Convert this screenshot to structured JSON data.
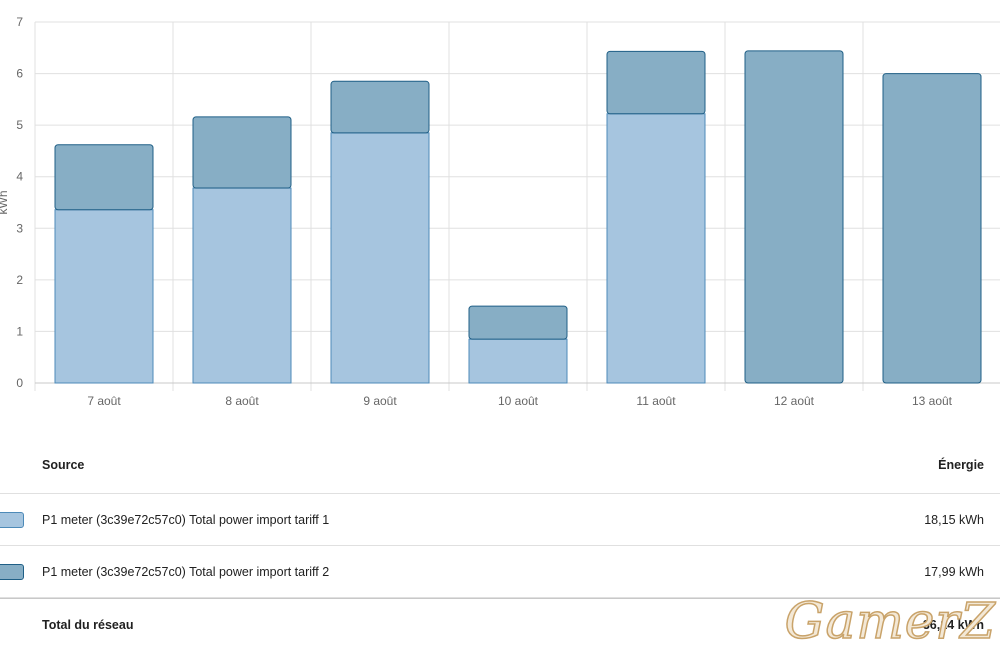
{
  "chart_data": {
    "type": "bar",
    "stacked": true,
    "ylabel": "kWh",
    "ylim": [
      0,
      7
    ],
    "yticks": [
      0,
      1,
      2,
      3,
      4,
      5,
      6,
      7
    ],
    "categories": [
      "7 août",
      "8 août",
      "9 août",
      "10 août",
      "11 août",
      "12 août",
      "13 août"
    ],
    "series": [
      {
        "name": "P1 meter (3c39e72c57c0) Total power import tariff 1",
        "values": [
          3.36,
          3.78,
          4.85,
          0.85,
          5.22,
          0,
          0
        ],
        "color": "#a6c5df",
        "border": "#4d8ab8"
      },
      {
        "name": "P1 meter (3c39e72c57c0) Total power import tariff 2",
        "values": [
          1.26,
          1.38,
          1.0,
          0.64,
          1.21,
          6.44,
          6.0
        ],
        "color": "#87aec5",
        "border": "#1f5f86"
      }
    ],
    "grid": true
  },
  "table": {
    "header_source": "Source",
    "header_energy": "Énergie",
    "rows": [
      {
        "source": "P1 meter (3c39e72c57c0) Total power import tariff 1",
        "energy": "18,15 kWh"
      },
      {
        "source": "P1 meter (3c39e72c57c0) Total power import tariff 2",
        "energy": "17,99 kWh"
      }
    ],
    "total_label": "Total du réseau",
    "total_value": "36,14 kWh"
  },
  "watermark": "GamerZ"
}
